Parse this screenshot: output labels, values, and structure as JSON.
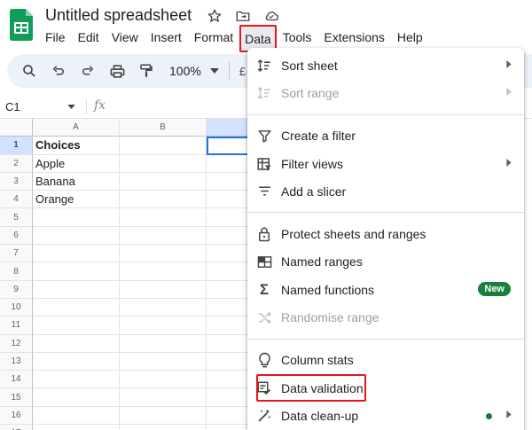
{
  "title": "Untitled spreadsheet",
  "menubar": [
    "File",
    "Edit",
    "View",
    "Insert",
    "Format",
    "Data",
    "Tools",
    "Extensions",
    "Help"
  ],
  "toolbar": {
    "zoom": "100%",
    "currency_partial": "£"
  },
  "formula_bar": {
    "cell_ref": "C1",
    "fx": "fx"
  },
  "columns": [
    "A",
    "B",
    ""
  ],
  "rows": [
    {
      "n": "1",
      "a": "Choices"
    },
    {
      "n": "2",
      "a": "Apple"
    },
    {
      "n": "3",
      "a": "Banana"
    },
    {
      "n": "4",
      "a": "Orange"
    },
    {
      "n": "5",
      "a": ""
    },
    {
      "n": "6",
      "a": ""
    },
    {
      "n": "7",
      "a": ""
    },
    {
      "n": "8",
      "a": ""
    },
    {
      "n": "9",
      "a": ""
    },
    {
      "n": "10",
      "a": ""
    },
    {
      "n": "11",
      "a": ""
    },
    {
      "n": "12",
      "a": ""
    },
    {
      "n": "13",
      "a": ""
    },
    {
      "n": "14",
      "a": ""
    },
    {
      "n": "15",
      "a": ""
    },
    {
      "n": "16",
      "a": ""
    },
    {
      "n": "17",
      "a": ""
    }
  ],
  "data_menu": {
    "sort_sheet": "Sort sheet",
    "sort_range": "Sort range",
    "create_filter": "Create a filter",
    "filter_views": "Filter views",
    "add_slicer": "Add a slicer",
    "protect": "Protect sheets and ranges",
    "named_ranges": "Named ranges",
    "named_functions": "Named functions",
    "new_badge": "New",
    "randomise": "Randomise range",
    "column_stats": "Column stats",
    "data_validation": "Data validation",
    "data_cleanup": "Data clean-up"
  },
  "colors": {
    "accent": "#1a73e8",
    "highlight_box": "#e8151b",
    "sheets_green": "#0f9d58",
    "badge_green": "#188038"
  }
}
